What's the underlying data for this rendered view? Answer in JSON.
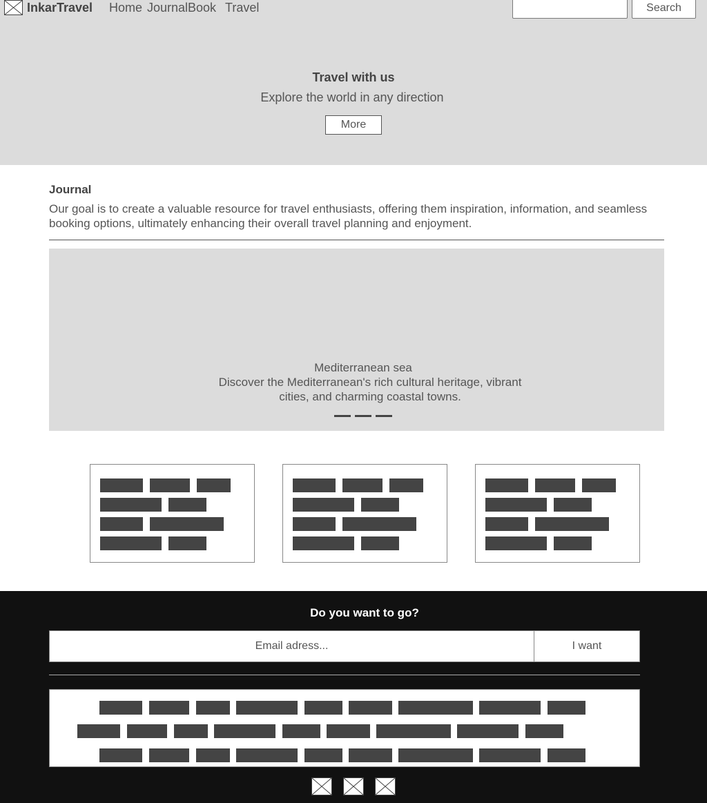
{
  "header": {
    "logo_icon": "image-placeholder-icon",
    "brand": "InkarTravel",
    "nav": [
      "Home",
      "Journal",
      "Book",
      "Travel"
    ],
    "search": {
      "value": "",
      "placeholder": "",
      "button": "Search"
    }
  },
  "hero": {
    "title": "Travel with us",
    "subtitle": "Explore the world in any direction",
    "button": "More"
  },
  "journal": {
    "title": "Journal",
    "description": "Our goal is to create a valuable resource for travel enthusiasts, offering them inspiration, information, and seamless booking options, ultimately enhancing their overall travel planning and enjoyment.",
    "carousel": {
      "title": "Mediterranean sea",
      "text": "Discover the Mediterranean's rich cultural heritage, vibrant cities, and charming coastal towns.",
      "slide_count": 3
    }
  },
  "cards_count": 3,
  "footer": {
    "title": "Do you want to go?",
    "email_placeholder": "Email adress...",
    "button": "I want",
    "social_icons": [
      "image-placeholder-icon",
      "image-placeholder-icon",
      "image-placeholder-icon"
    ]
  },
  "colors": {
    "hero_bg": "#dcdcdc",
    "footer_bg": "#111111",
    "placeholder_block": "#444444"
  }
}
